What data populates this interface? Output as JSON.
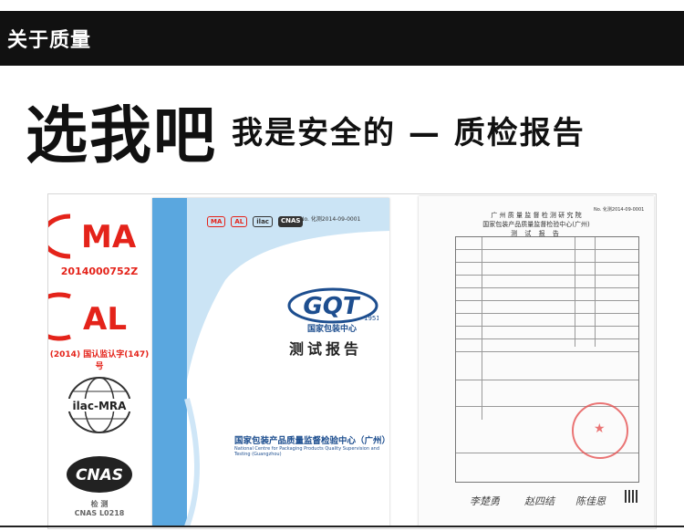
{
  "header": {
    "title": "关于质量"
  },
  "headline": {
    "main": "选我吧",
    "sub": "我是安全的 — 质检报告"
  },
  "logos": {
    "cma": {
      "mark": "MA",
      "code": "2014000752Z"
    },
    "cal": {
      "mark": "AL",
      "caption": "(2014) 国认监认字(147) 号"
    },
    "ilac": {
      "mark": "ilac-MRA"
    },
    "cnas": {
      "mark": "CNAS",
      "caption1": "检 测",
      "caption2": "CNAS L0218"
    }
  },
  "cover": {
    "small_logos": [
      "MA",
      "AL",
      "ilac",
      "CNAS"
    ],
    "doc_no": "No. 化测2014-09-0001",
    "brand": "GQT",
    "brand_year": "1951",
    "brand_name": "国家包装中心",
    "title": "测试报告",
    "org": "国家包装产品质量监督检验中心（广州）",
    "org_en": "National Centre for Packaging Products Quality Supervision and Testing (Guangzhou)"
  },
  "report": {
    "line1": "广 州 质 量 监 督 检 测 研 究 院",
    "line2": "国家包装产品质量监督检验中心(广州)",
    "line3": "测 试 报 告",
    "doc_no": "No. 化测2014-09-0001",
    "signatures": [
      "李楚勇",
      "赵四结",
      "陈佳恩"
    ]
  },
  "colors": {
    "accent_red": "#e4231a",
    "cover_blue": "#5aa7df",
    "brand_blue": "#1d4e8f",
    "bar": "#111111"
  }
}
